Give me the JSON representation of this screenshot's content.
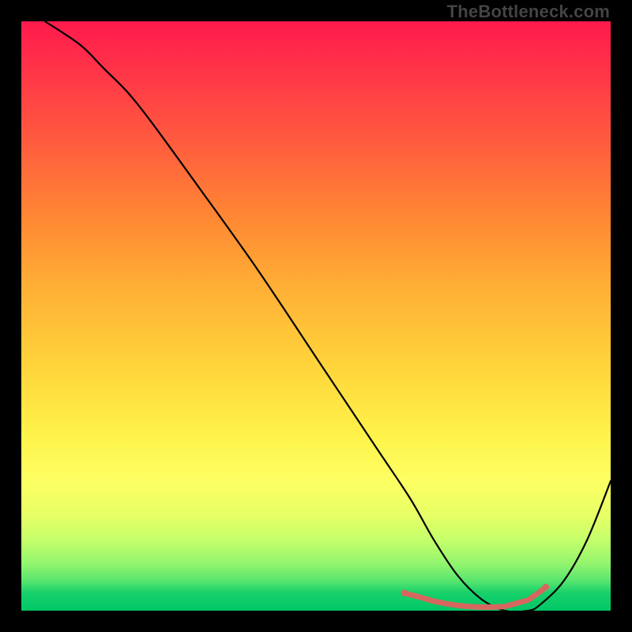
{
  "watermark": "TheBottleneck.com",
  "chart_data": {
    "type": "line",
    "title": "",
    "xlabel": "",
    "ylabel": "",
    "xlim": [
      0,
      100
    ],
    "ylim": [
      0,
      100
    ],
    "grid": false,
    "series": [
      {
        "name": "bottleneck-curve",
        "x": [
          4,
          10,
          14,
          18,
          22,
          30,
          40,
          50,
          60,
          66,
          70,
          74,
          78,
          82,
          86,
          88,
          92,
          96,
          100
        ],
        "y": [
          100,
          96,
          92,
          88,
          83,
          72,
          58,
          43,
          28,
          19,
          12,
          6,
          2,
          0,
          0,
          1,
          5,
          12,
          22
        ]
      }
    ],
    "markers": {
      "name": "highlighted-range",
      "color": "#d6675f",
      "points_x": [
        65,
        68,
        70,
        72,
        74,
        76,
        78,
        80,
        82,
        86,
        88,
        89
      ],
      "points_y": [
        3,
        2.2,
        1.6,
        1.2,
        0.9,
        0.7,
        0.6,
        0.6,
        0.7,
        1.8,
        3.2,
        4
      ]
    },
    "background_gradient": {
      "top": "#ff1a4d",
      "mid": "#ffd33a",
      "bottom": "#00c767"
    }
  }
}
